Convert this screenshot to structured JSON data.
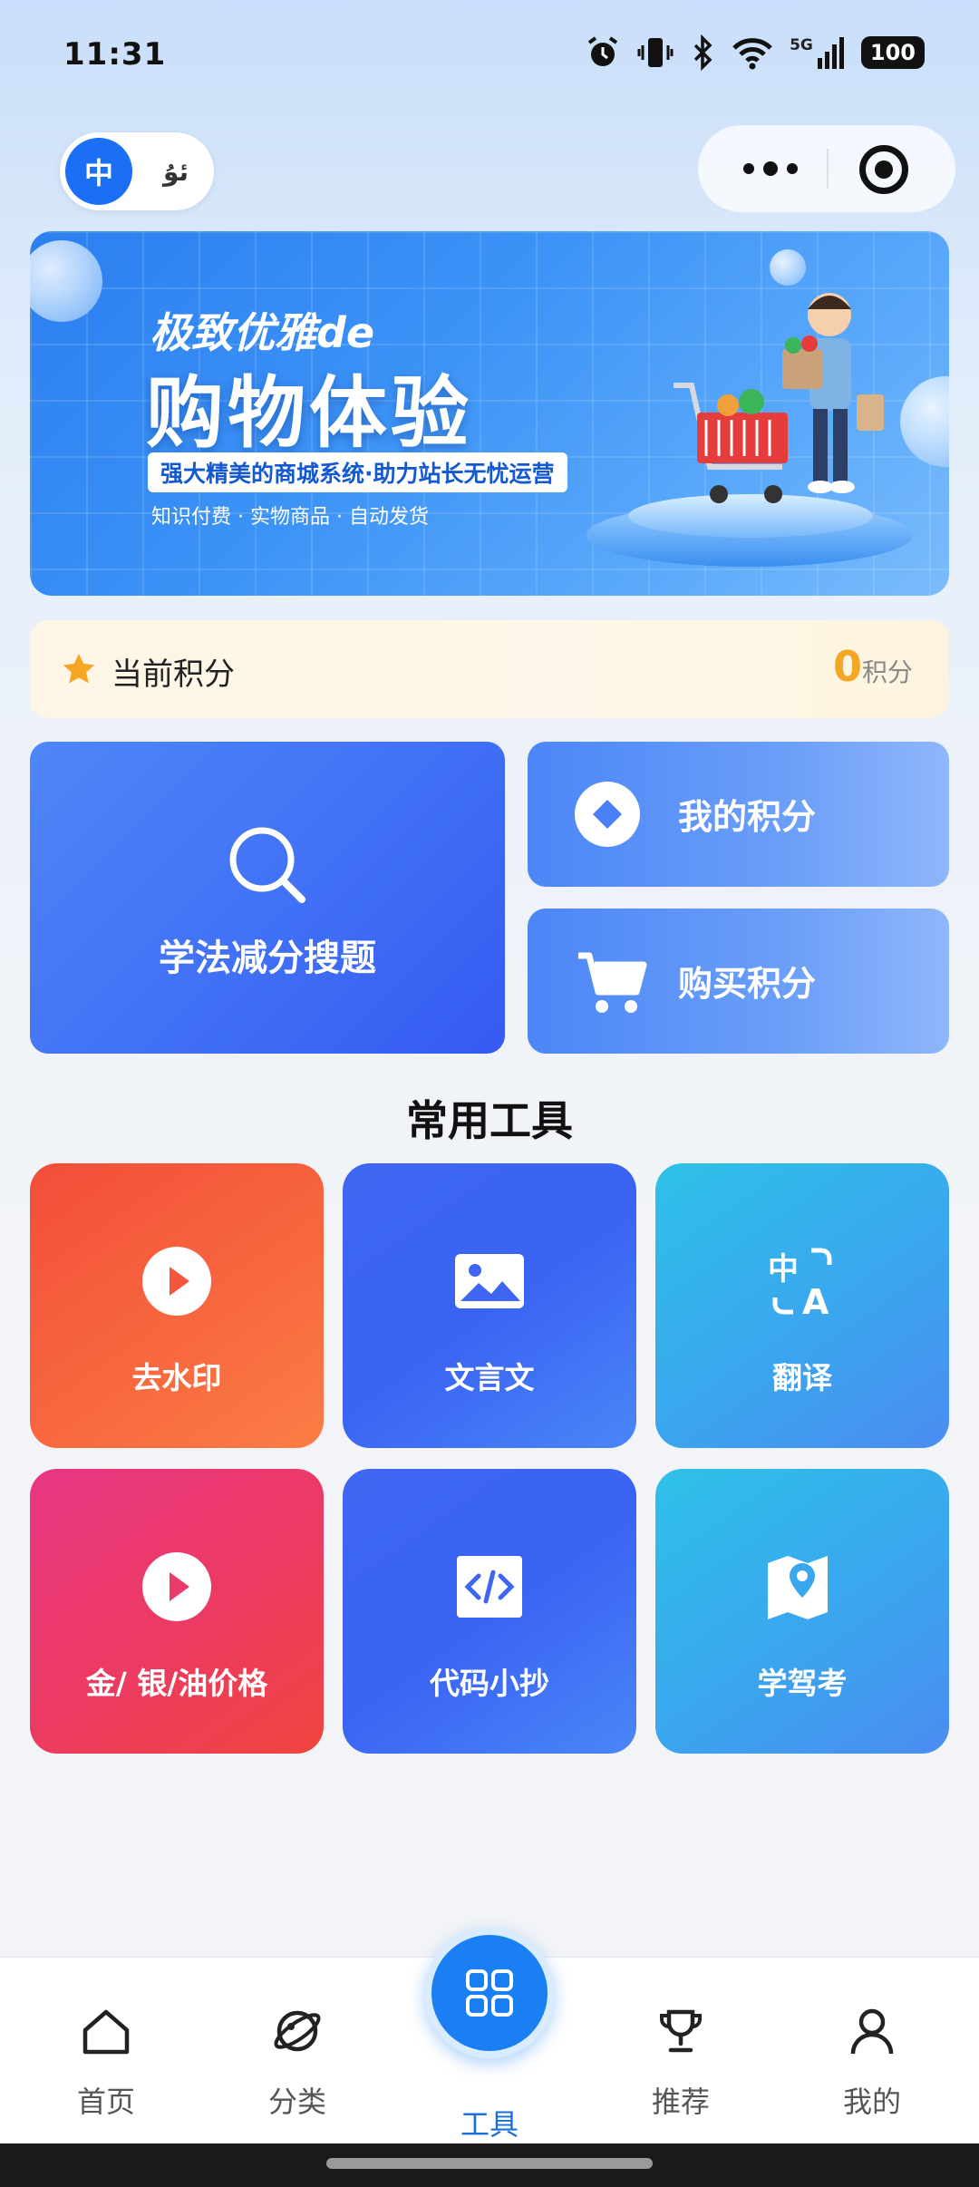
{
  "status_bar": {
    "time": "11:31",
    "network": "5G",
    "battery": "100"
  },
  "header": {
    "lang_active": "中",
    "lang_other": "ئۇ"
  },
  "banner": {
    "title_line1": "极致优雅de",
    "title_line2": "购物体验",
    "tagline": "强大精美的商城系统·助力站长无忧运营",
    "subtitle": "知识付费 · 实物商品 · 自动发货"
  },
  "points": {
    "label": "当前积分",
    "value": "0",
    "unit": "积分"
  },
  "features": {
    "search_label": "学法减分搜题",
    "my_points_label": "我的积分",
    "buy_points_label": "购买积分"
  },
  "tools": {
    "section_title": "常用工具",
    "items": [
      {
        "label": "去水印",
        "icon": "play-icon"
      },
      {
        "label": "文言文",
        "icon": "image-icon"
      },
      {
        "label": "翻译",
        "icon": "translate-icon"
      },
      {
        "label": "金/ 银/油价格",
        "icon": "play-icon"
      },
      {
        "label": "代码小抄",
        "icon": "code-icon"
      },
      {
        "label": "学驾考",
        "icon": "map-pin-icon"
      }
    ]
  },
  "bottom_nav": {
    "items": [
      {
        "label": "首页",
        "icon": "home-icon"
      },
      {
        "label": "分类",
        "icon": "planet-icon"
      },
      {
        "label": "工具",
        "icon": "grid-icon"
      },
      {
        "label": "推荐",
        "icon": "trophy-icon"
      },
      {
        "label": "我的",
        "icon": "user-icon"
      }
    ],
    "active_index": 2
  },
  "colors": {
    "primary": "#1a7ff2",
    "points_value": "#f5a623",
    "orange_card": "#f8693f",
    "blue_card": "#3f66f3",
    "cyan_card": "#3aa6ee",
    "pink_card": "#ec3b62"
  }
}
